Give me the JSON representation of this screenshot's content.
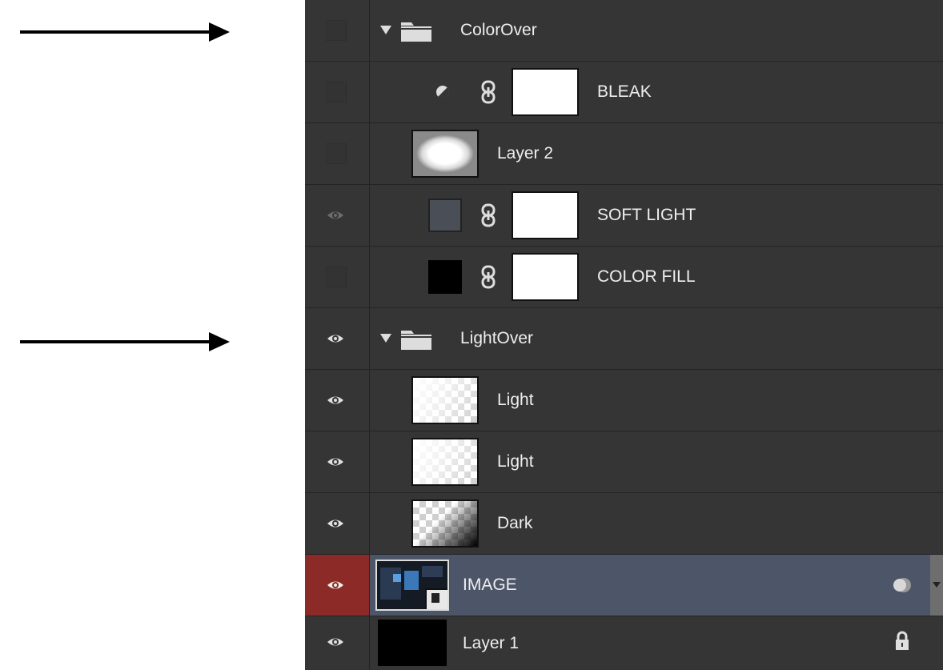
{
  "layers": [
    {
      "name": "ColorOver",
      "visible": false,
      "kind": "group",
      "icon": "folder-icon"
    },
    {
      "name": "BLEAK",
      "visible": false,
      "kind": "adjustment",
      "icon": "adjustment-circle-icon"
    },
    {
      "name": "Layer 2",
      "visible": false,
      "kind": "pixel",
      "icon": "white-glow-thumbnail"
    },
    {
      "name": "SOFT LIGHT",
      "visible": true,
      "kind": "fill",
      "icon": "gray-swatch",
      "swatch_color": "#4a4e56"
    },
    {
      "name": "COLOR FILL",
      "visible": false,
      "kind": "fill",
      "icon": "black-swatch",
      "swatch_color": "#000000"
    },
    {
      "name": "LightOver",
      "visible": true,
      "kind": "group",
      "icon": "folder-icon"
    },
    {
      "name": "Light",
      "visible": true,
      "kind": "pixel",
      "icon": "light-gradient-thumbnail"
    },
    {
      "name": "Light",
      "visible": true,
      "kind": "pixel",
      "icon": "light-gradient-thumbnail"
    },
    {
      "name": "Dark",
      "visible": true,
      "kind": "pixel",
      "icon": "dark-gradient-thumbnail"
    },
    {
      "name": "IMAGE",
      "visible": true,
      "kind": "smart-object",
      "selected": true,
      "icon": "smart-object-thumbnail",
      "badge_icon": "smart-filter-icon"
    },
    {
      "name": "Layer 1",
      "visible": true,
      "kind": "pixel",
      "locked": true,
      "icon": "black-thumbnail",
      "badge_icon": "lock-icon"
    }
  ],
  "colors": {
    "panel_bg": "#353535",
    "selected_row": "#4d5568",
    "selected_eye_cell": "#8b2a26",
    "divider": "#242424"
  }
}
